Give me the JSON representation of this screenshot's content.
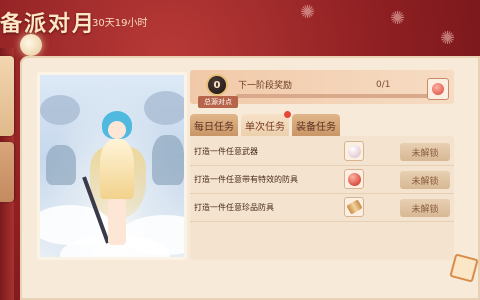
{
  "header": {
    "title": "备派对月",
    "timer": "30天19小时"
  },
  "progress": {
    "label": "下一阶段奖励",
    "count": "0/1",
    "percent": 0,
    "points_value": "0",
    "points_caption": "总源对点"
  },
  "tabs": [
    {
      "label": "每日任务",
      "active": false
    },
    {
      "label": "单次任务",
      "active": true,
      "has_dot": true
    },
    {
      "label": "装备任务",
      "active": false
    }
  ],
  "tasks": [
    {
      "name": "打造一件任意武器",
      "item_icon": "pearl-icon",
      "button": "未解锁"
    },
    {
      "name": "打造一件任意带有特效的防具",
      "item_icon": "red-orb-icon",
      "button": "未解锁"
    },
    {
      "name": "打造一件任意珍品防具",
      "item_icon": "scroll-icon",
      "button": "未解锁"
    }
  ]
}
